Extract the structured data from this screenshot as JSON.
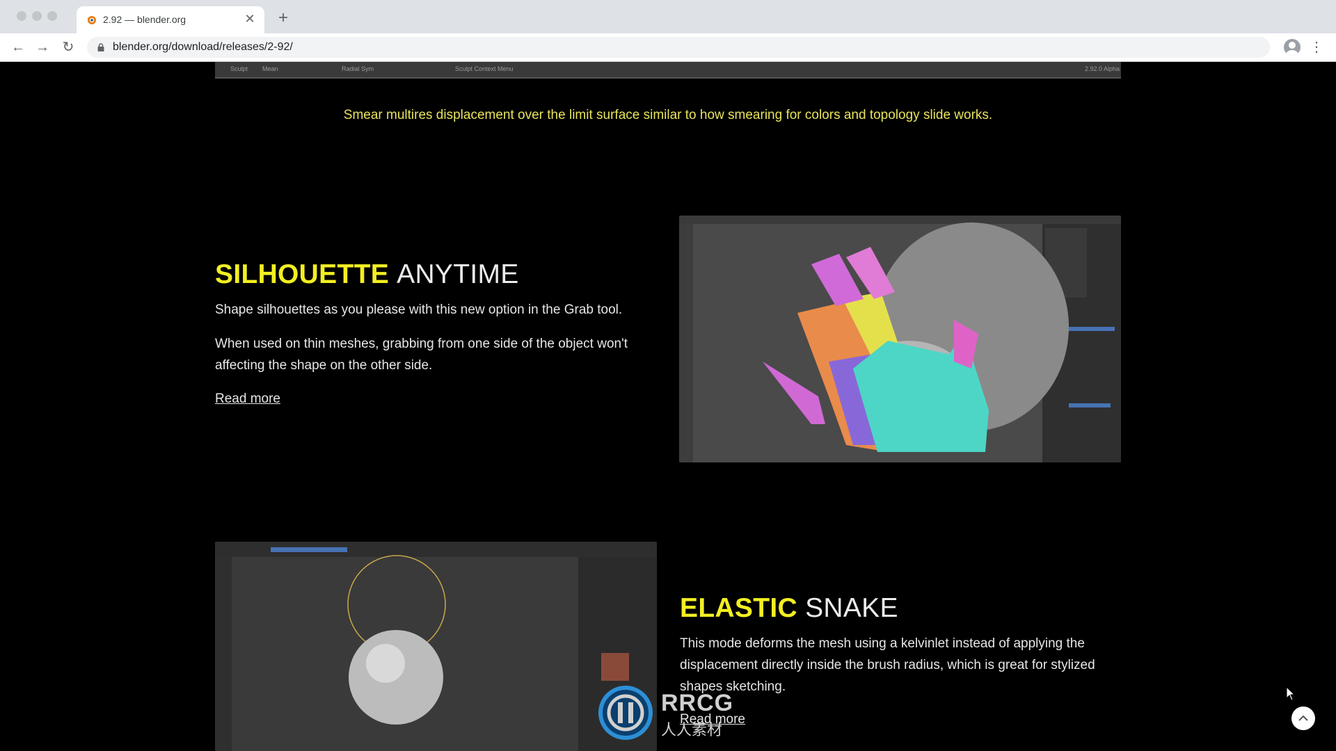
{
  "browser": {
    "tab_title": "2.92 — blender.org",
    "url": "blender.org/download/releases/2-92/",
    "tab_close_glyph": "✕",
    "new_tab_glyph": "+",
    "back_glyph": "←",
    "forward_glyph": "→",
    "reload_glyph": "↻",
    "star_glyph": "☆",
    "menu_glyph": "⋮"
  },
  "page": {
    "top_strip_items": [
      "Sculpt",
      "Mean",
      "Radial Sym",
      "Sculpt Context Menu",
      "2.92.0 Alpha"
    ],
    "caption": "Smear multires displacement over the limit surface similar to how smearing for colors and topology slide works.",
    "sections": [
      {
        "heading_highlight": "SILHOUETTE",
        "heading_rest": "ANYTIME",
        "paragraphs": [
          "Shape silhouettes as you please with this new option in the Grab tool.",
          "When used on thin meshes, grabbing from one side of the object won't affecting the shape on the other side."
        ],
        "link": "Read more"
      },
      {
        "heading_highlight": "ELASTIC",
        "heading_rest": "SNAKE",
        "paragraphs": [
          "This mode deforms the mesh using a kelvinlet instead of applying the displacement directly inside the brush radius, which is great for stylized shapes sketching."
        ],
        "link": "Read more"
      }
    ]
  },
  "watermark": {
    "text": "RRCG",
    "subtext": "人人素材"
  },
  "colors": {
    "accent_yellow": "#f2ef22",
    "caption_yellow": "#e8e35c",
    "page_bg": "#000000"
  },
  "icons": [
    "blender-favicon",
    "lock-icon",
    "star-icon",
    "avatar-icon",
    "chevron-up-icon",
    "mouse-cursor"
  ]
}
